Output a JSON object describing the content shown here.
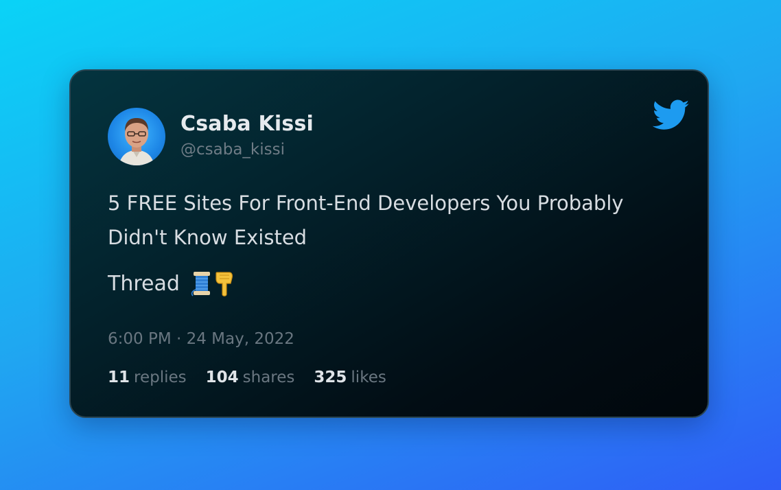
{
  "tweet": {
    "author_name": "Csaba Kissi",
    "author_handle": "@csaba_kissi",
    "text": "5 FREE Sites For Front-End Developers You Probably Didn't Know Existed",
    "thread_label": "Thread",
    "emoji": [
      "spool-of-thread",
      "backhand-index-pointing-down"
    ],
    "timestamp": "6:00 PM · 24 May, 2022",
    "stats": {
      "replies_count": "11",
      "replies_label": "replies",
      "shares_count": "104",
      "shares_label": "shares",
      "likes_count": "325",
      "likes_label": "likes"
    }
  },
  "icons": {
    "brand": "twitter-bird-icon"
  },
  "colors": {
    "background_start": "#0ad3f7",
    "background_end": "#2f5df6",
    "card_bg": "#03222c",
    "twitter_blue": "#1d9bf0",
    "primary_text": "#d8dde2",
    "muted_text": "#6a7781"
  }
}
